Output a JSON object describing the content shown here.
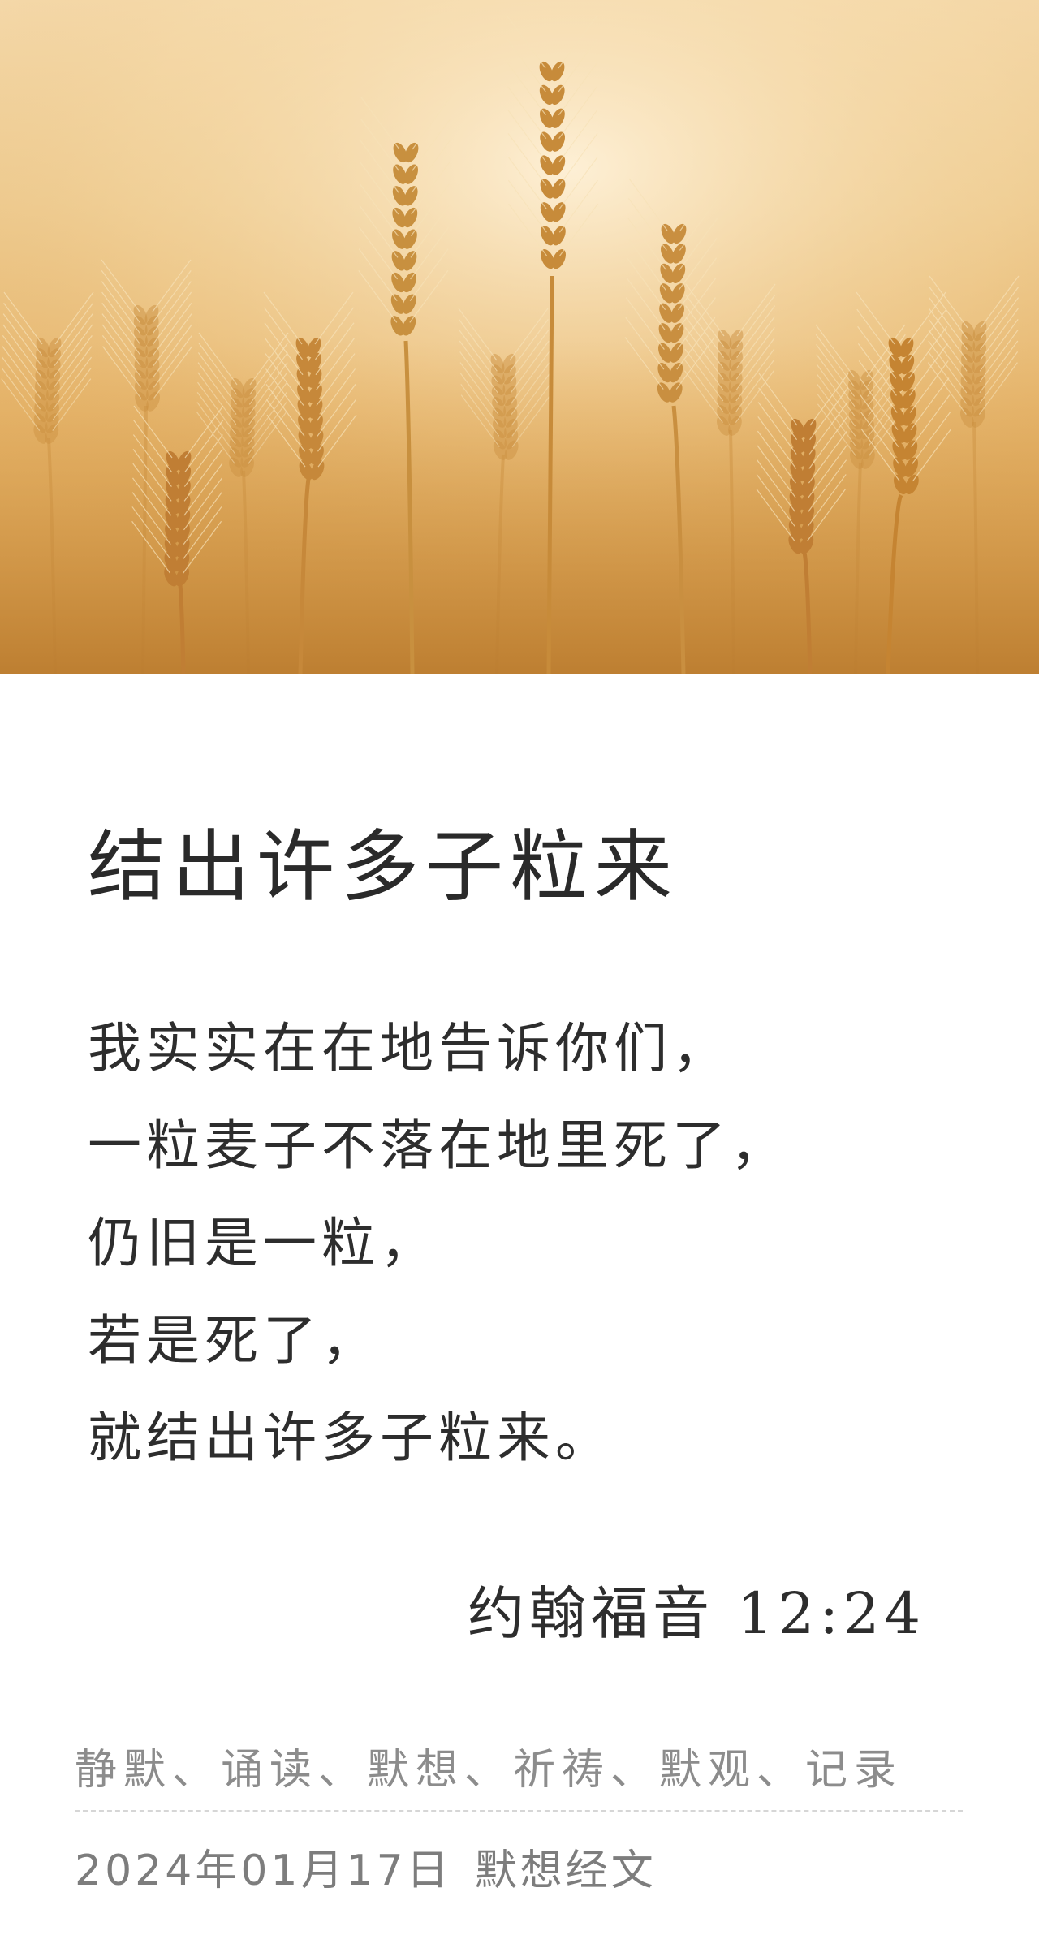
{
  "hero": {
    "icon": "wheat-field-image"
  },
  "article": {
    "title": "结出许多子粒来",
    "verse_lines": [
      "我实实在在地告诉你们，",
      "一粒麦子不落在地里死了，",
      "仍旧是一粒，",
      "若是死了，",
      "就结出许多子粒来。"
    ],
    "reference": "约翰福音 12:24"
  },
  "footer": {
    "practices": "静默、诵读、默想、祈祷、默观、记录",
    "date": "2024年01月17日",
    "category": "默想经文"
  },
  "colors": {
    "wheat_light": "#f6dcaf",
    "wheat_dark": "#c58432",
    "text": "#2d2d2d",
    "muted": "#8c8c8c"
  }
}
